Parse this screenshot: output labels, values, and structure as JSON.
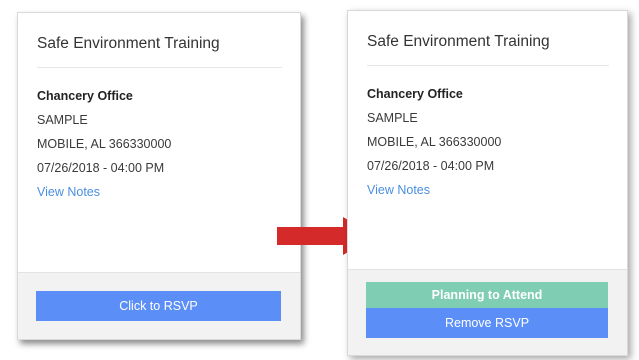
{
  "left_card": {
    "title": "Safe Environment Training",
    "location_name": "Chancery Office",
    "address_line": "SAMPLE",
    "city_line": "MOBILE, AL 366330000",
    "datetime": "07/26/2018 - 04:00 PM",
    "notes_link": "View Notes",
    "rsvp_button": "Click to RSVP"
  },
  "right_card": {
    "title": "Safe Environment Training",
    "location_name": "Chancery Office",
    "address_line": "SAMPLE",
    "city_line": "MOBILE, AL 366330000",
    "datetime": "07/26/2018 - 04:00 PM",
    "notes_link": "View Notes",
    "status_button": "Planning to Attend",
    "remove_button": "Remove RSVP"
  },
  "colors": {
    "primary_button": "#5b8ff7",
    "success_button": "#7fcdb3",
    "link": "#4a8fe0",
    "arrow": "#d42a2a"
  },
  "icons": {
    "transition": "right-arrow-icon"
  }
}
